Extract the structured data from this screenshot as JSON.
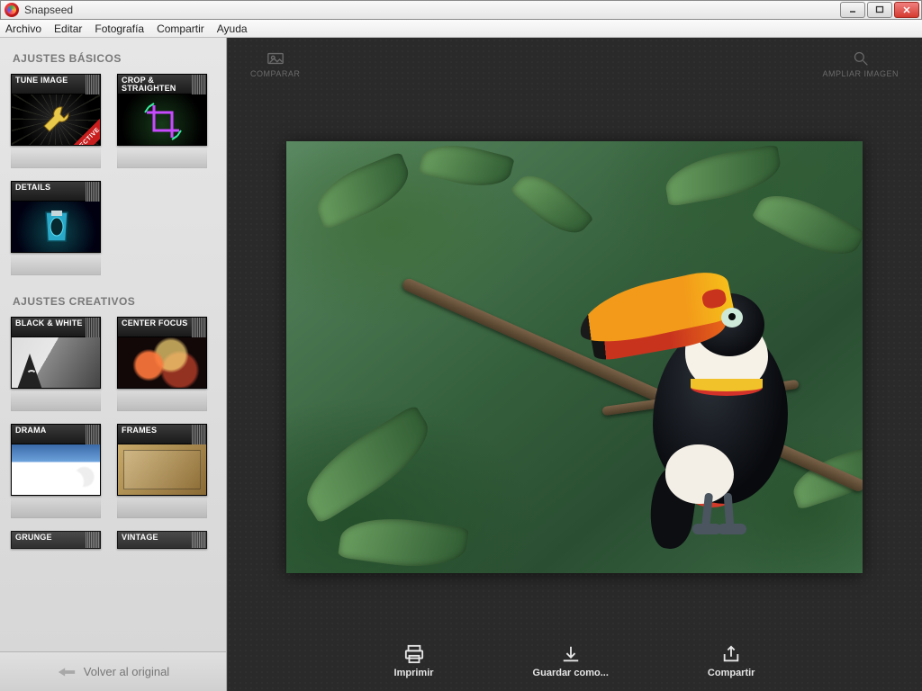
{
  "window": {
    "title": "Snapseed"
  },
  "menu": {
    "file": "Archivo",
    "edit": "Editar",
    "photography": "Fotografía",
    "share": "Compartir",
    "help": "Ayuda"
  },
  "topbar": {
    "compare": "COMPARAR",
    "zoom": "AMPLIAR IMAGEN"
  },
  "sidebar": {
    "basic_title": "AJUSTES BÁSICOS",
    "creative_title": "AJUSTES CREATIVOS",
    "revert": "Volver al original",
    "basic": [
      {
        "label": "TUNE IMAGE",
        "ribbon": "SELECTIVE"
      },
      {
        "label": "CROP & STRAIGHTEN"
      },
      {
        "label": "DETAILS"
      }
    ],
    "creative": [
      {
        "label": "BLACK & WHITE"
      },
      {
        "label": "CENTER FOCUS"
      },
      {
        "label": "DRAMA"
      },
      {
        "label": "FRAMES"
      },
      {
        "label": "GRUNGE"
      },
      {
        "label": "VINTAGE"
      }
    ]
  },
  "actions": {
    "print": "Imprimir",
    "saveas": "Guardar como...",
    "share": "Compartir"
  },
  "image": {
    "subject": "toucan on branch with green foliage"
  }
}
